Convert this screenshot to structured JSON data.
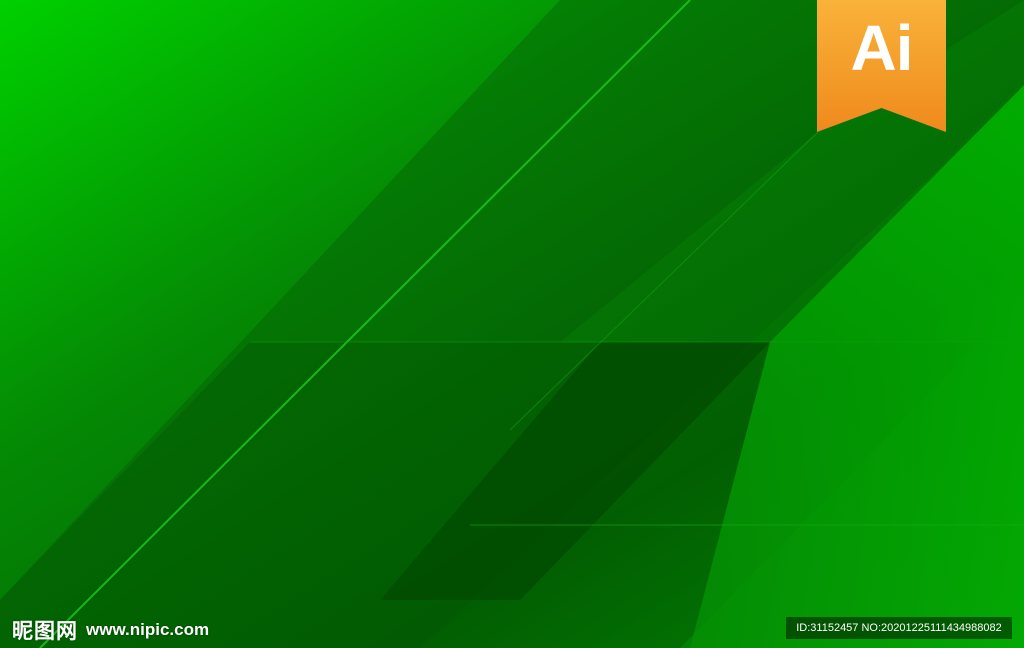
{
  "badge": {
    "text": "Ai"
  },
  "watermark": {
    "logo": "昵图网",
    "url": "www.nipic.com"
  },
  "id_strip": {
    "text": "ID:31152457 NO:20201225111434988082"
  },
  "colors": {
    "bright_green": "#00d400",
    "dark_green": "#024a02",
    "badge_orange": "#f7a12a",
    "badge_orange_dark": "#ef8a1d"
  }
}
